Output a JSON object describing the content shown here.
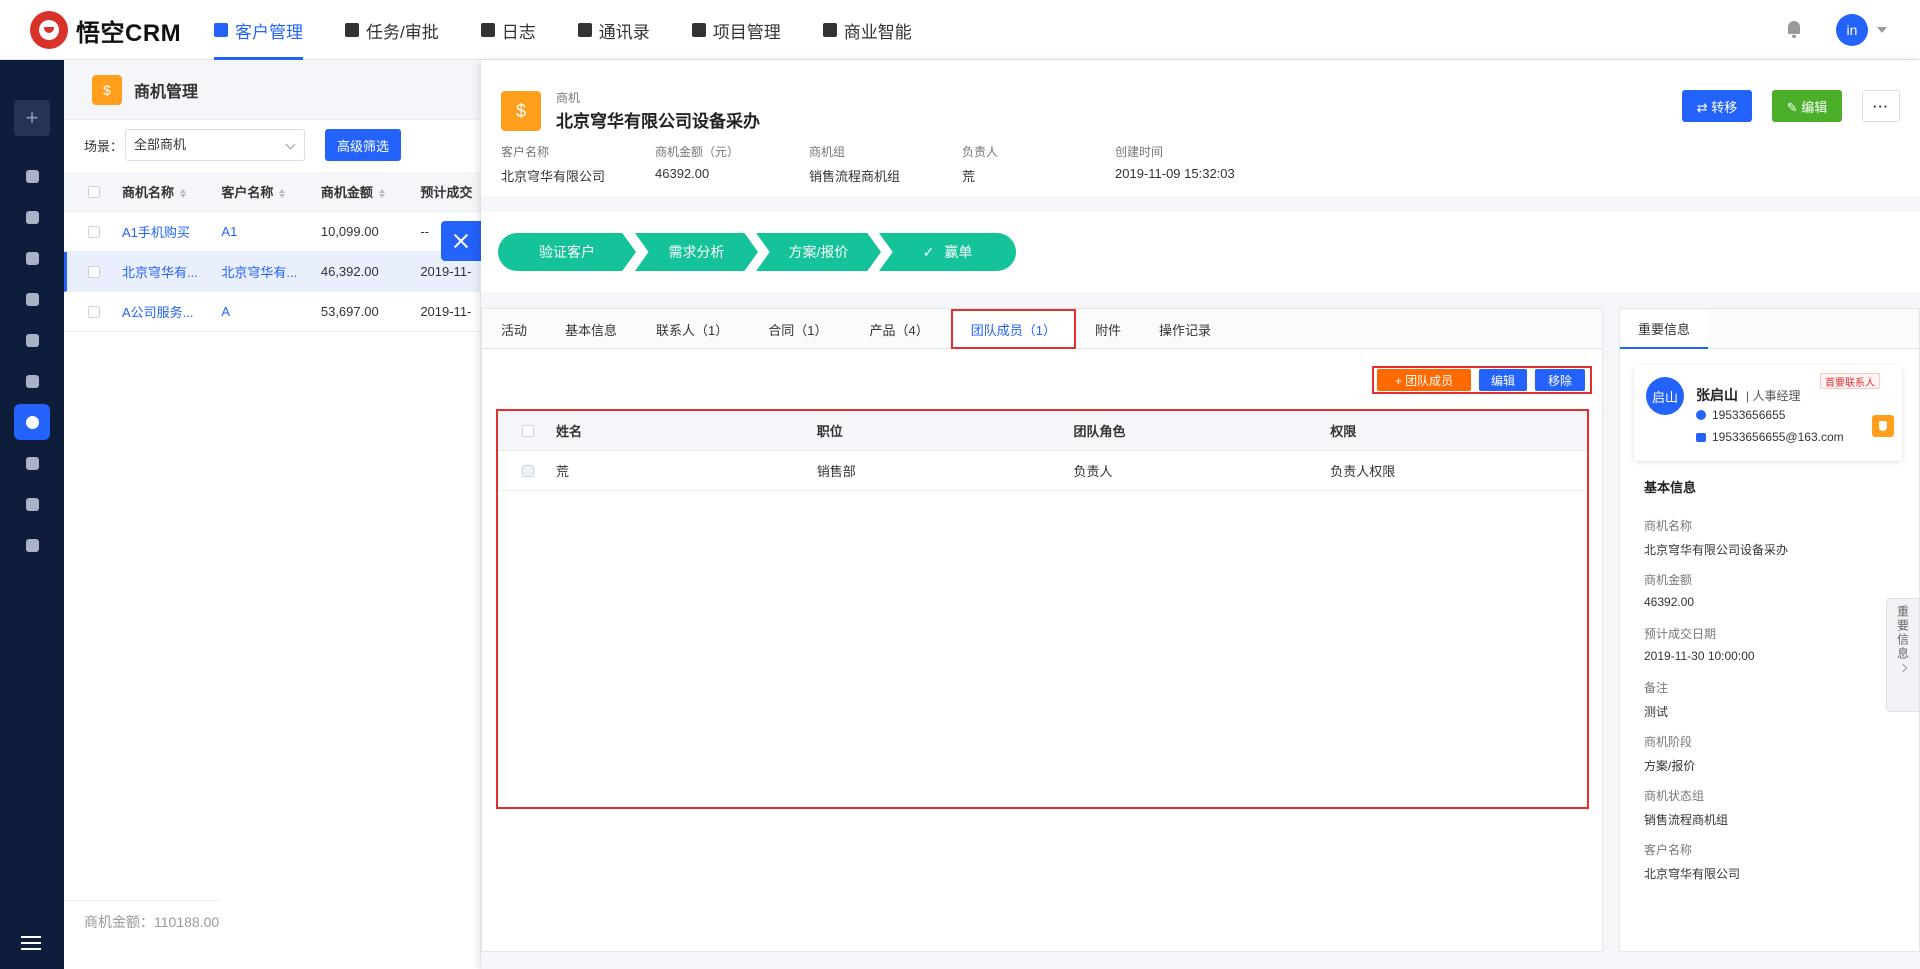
{
  "app": {
    "logo_text": "悟空CRM"
  },
  "nav": [
    {
      "label": "客户管理",
      "icon": "customer-icon",
      "active": true
    },
    {
      "label": "任务/审批",
      "icon": "briefcase-icon"
    },
    {
      "label": "日志",
      "icon": "log-icon"
    },
    {
      "label": "通讯录",
      "icon": "contacts-icon"
    },
    {
      "label": "项目管理",
      "icon": "project-icon"
    },
    {
      "label": "商业智能",
      "icon": "bi-icon"
    }
  ],
  "user": {
    "avatar_text": "in"
  },
  "sidebar": {
    "add": "+",
    "icons": [
      "dashboard-icon",
      "message-icon",
      "transfer-icon",
      "building-icon",
      "contact-card-icon",
      "leads-icon",
      "business-icon",
      "contract-icon",
      "money-bag-icon",
      "product-icon"
    ],
    "active": "business-icon"
  },
  "list": {
    "title": "商机管理",
    "title_icon": "$",
    "scene_label": "场景：",
    "scene_value": "全部商机",
    "advanced_filter": "高级筛选",
    "headers": [
      "商机名称",
      "客户名称",
      "商机金额",
      "预计成交"
    ],
    "rows": [
      {
        "name": "A1手机购买",
        "customer": "A1",
        "amount": "10,099.00",
        "date": "--"
      },
      {
        "name": "北京穹华有...",
        "customer": "北京穹华有...",
        "amount": "46,392.00",
        "date": "2019-11-"
      },
      {
        "name": "A公司服务...",
        "customer": "A",
        "amount": "53,697.00",
        "date": "2019-11-"
      }
    ],
    "total": "商机金额：110188.00"
  },
  "detail": {
    "icon": "$",
    "type": "商机",
    "name": "北京穹华有限公司设备采办",
    "meta": [
      {
        "k": "客户名称",
        "v": "北京穹华有限公司"
      },
      {
        "k": "商机金额（元）",
        "v": "46392.00"
      },
      {
        "k": "商机组",
        "v": "销售流程商机组"
      },
      {
        "k": "负责人",
        "v": "荒"
      },
      {
        "k": "创建时间",
        "v": "2019-11-09 15:32:03"
      }
    ],
    "buttons": {
      "transfer": "⇄ 转移",
      "edit": "✎ 编辑",
      "more": "···"
    },
    "stages": [
      "验证客户",
      "需求分析",
      "方案/报价",
      "赢单"
    ],
    "stage_check": "✓",
    "tabs": [
      "活动",
      "基本信息",
      "联系人（1）",
      "合同（1）",
      "产品（4）",
      "团队成员（1）",
      "附件",
      "操作记录"
    ],
    "active_tab": "团队成员（1）",
    "team_tools": {
      "add": "+   团队成员",
      "edit": "编辑",
      "remove": "移除"
    },
    "team_headers": [
      "姓名",
      "职位",
      "团队角色",
      "权限"
    ],
    "team_rows": [
      {
        "name": "荒",
        "post": "销售部",
        "role": "负责人",
        "perm": "负责人权限"
      }
    ]
  },
  "side": {
    "tab": "重要信息",
    "contact": {
      "avatar": "启山",
      "name": "张启山",
      "post": "| 人事经理",
      "badge": "首要联系人",
      "phone": "19533656655",
      "email": "19533656655@163.com"
    },
    "basic_title": "基本信息",
    "fields": [
      {
        "k": "商机名称",
        "v": "北京穹华有限公司设备采办"
      },
      {
        "k": "商机金额",
        "v": "46392.00"
      },
      {
        "k": "预计成交日期",
        "v": "2019-11-30 10:00:00"
      },
      {
        "k": "备注",
        "v": "测试"
      },
      {
        "k": "商机阶段",
        "v": "方案/报价"
      },
      {
        "k": "商机状态组",
        "v": "销售流程商机组"
      },
      {
        "k": "客户名称",
        "v": "北京穹华有限公司"
      }
    ],
    "handle": "重要信息"
  }
}
